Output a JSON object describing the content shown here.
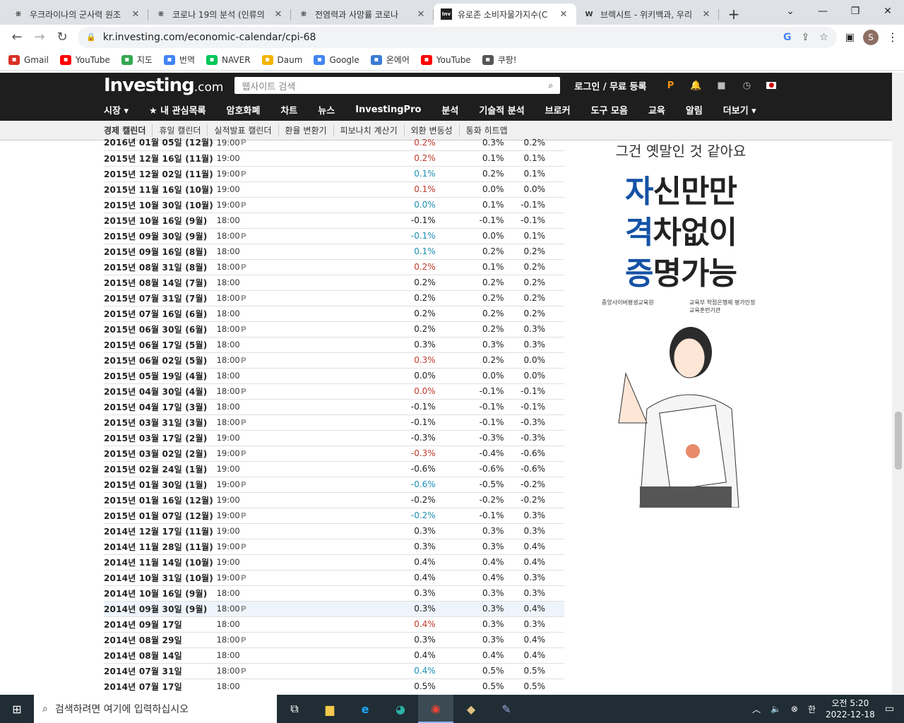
{
  "browser": {
    "tabs": [
      {
        "title": "우크라이나의 군사력 원조",
        "fav": "⁜"
      },
      {
        "title": "코로나 19의 분석 (인류의",
        "fav": "⁜"
      },
      {
        "title": "전염력과 사망률 코로나",
        "fav": "⁜"
      },
      {
        "title": "유로존 소비자물가지수(C",
        "fav": "Inv",
        "active": true
      },
      {
        "title": "브렉시트 - 위키백과, 우리",
        "fav": "W"
      }
    ],
    "url": "kr.investing.com/economic-calendar/cpi-68",
    "profile": "S",
    "bookmarks": [
      {
        "label": "Gmail",
        "icon": "gmail-icon",
        "color": "#d93025"
      },
      {
        "label": "YouTube",
        "icon": "youtube-icon",
        "color": "#ff0000"
      },
      {
        "label": "지도",
        "icon": "maps-icon",
        "color": "#34a853"
      },
      {
        "label": "번역",
        "icon": "translate-icon",
        "color": "#4285f4"
      },
      {
        "label": "NAVER",
        "icon": "naver-icon",
        "color": "#03c75a"
      },
      {
        "label": "Daum",
        "icon": "daum-icon",
        "color": "#f4b400"
      },
      {
        "label": "Google",
        "icon": "google-icon",
        "color": "#4285f4"
      },
      {
        "label": "온에어",
        "icon": "onair-icon",
        "color": "#3a7bd5"
      },
      {
        "label": "YouTube",
        "icon": "youtube-icon",
        "color": "#ff0000"
      },
      {
        "label": "쿠팡!",
        "icon": "coupang-icon",
        "color": "#555"
      }
    ]
  },
  "site": {
    "logo": "Investing",
    "logo_suffix": ".com",
    "search_placeholder": "웹사이트 검색",
    "login": "로그인 / 무료 등록",
    "nav": [
      "시장 ▾",
      "★ 내 관심목록",
      "암호화폐",
      "차트",
      "뉴스",
      "InvestingPro",
      "분석",
      "기술적 분석",
      "브로커",
      "도구 모음",
      "교육",
      "알림",
      "더보기 ▾"
    ],
    "subnav": [
      "경제 캘린더",
      "휴일 캘린더",
      "실적발표 캘린더",
      "환율 변환기",
      "피보나치 계산기",
      "외환 변동성",
      "통화 히트맵"
    ]
  },
  "table": {
    "rows": [
      {
        "date": "2016년 01월 05일 (12월)",
        "time": "19:00",
        "pre": "P",
        "actual": "0.2%",
        "ac": "red",
        "forecast": "0.3%",
        "prev": "0.2%"
      },
      {
        "date": "2015년 12월 16일 (11월)",
        "time": "19:00",
        "pre": "",
        "actual": "0.2%",
        "ac": "red",
        "forecast": "0.1%",
        "prev": "0.1%"
      },
      {
        "date": "2015년 12월 02일 (11월)",
        "time": "19:00",
        "pre": "P",
        "actual": "0.1%",
        "ac": "green",
        "forecast": "0.2%",
        "prev": "0.1%"
      },
      {
        "date": "2015년 11월 16일 (10월)",
        "time": "19:00",
        "pre": "",
        "actual": "0.1%",
        "ac": "red",
        "forecast": "0.0%",
        "prev": "0.0%"
      },
      {
        "date": "2015년 10월 30일 (10월)",
        "time": "19:00",
        "pre": "P",
        "actual": "0.0%",
        "ac": "green",
        "forecast": "0.1%",
        "prev": "-0.1%"
      },
      {
        "date": "2015년 10월 16일 (9월)",
        "time": "18:00",
        "pre": "",
        "actual": "-0.1%",
        "ac": "",
        "forecast": "-0.1%",
        "prev": "-0.1%"
      },
      {
        "date": "2015년 09월 30일 (9월)",
        "time": "18:00",
        "pre": "P",
        "actual": "-0.1%",
        "ac": "green",
        "forecast": "0.0%",
        "prev": "0.1%"
      },
      {
        "date": "2015년 09월 16일 (8월)",
        "time": "18:00",
        "pre": "",
        "actual": "0.1%",
        "ac": "green",
        "forecast": "0.2%",
        "prev": "0.2%"
      },
      {
        "date": "2015년 08월 31일 (8월)",
        "time": "18:00",
        "pre": "P",
        "actual": "0.2%",
        "ac": "red",
        "forecast": "0.1%",
        "prev": "0.2%"
      },
      {
        "date": "2015년 08월 14일 (7월)",
        "time": "18:00",
        "pre": "",
        "actual": "0.2%",
        "ac": "",
        "forecast": "0.2%",
        "prev": "0.2%"
      },
      {
        "date": "2015년 07월 31일 (7월)",
        "time": "18:00",
        "pre": "P",
        "actual": "0.2%",
        "ac": "",
        "forecast": "0.2%",
        "prev": "0.2%"
      },
      {
        "date": "2015년 07월 16일 (6월)",
        "time": "18:00",
        "pre": "",
        "actual": "0.2%",
        "ac": "",
        "forecast": "0.2%",
        "prev": "0.2%"
      },
      {
        "date": "2015년 06월 30일 (6월)",
        "time": "18:00",
        "pre": "P",
        "actual": "0.2%",
        "ac": "",
        "forecast": "0.2%",
        "prev": "0.3%"
      },
      {
        "date": "2015년 06월 17일 (5월)",
        "time": "18:00",
        "pre": "",
        "actual": "0.3%",
        "ac": "",
        "forecast": "0.3%",
        "prev": "0.3%"
      },
      {
        "date": "2015년 06월 02일 (5월)",
        "time": "18:00",
        "pre": "P",
        "actual": "0.3%",
        "ac": "red",
        "forecast": "0.2%",
        "prev": "0.0%"
      },
      {
        "date": "2015년 05월 19일 (4월)",
        "time": "18:00",
        "pre": "",
        "actual": "0.0%",
        "ac": "",
        "forecast": "0.0%",
        "prev": "0.0%"
      },
      {
        "date": "2015년 04월 30일 (4월)",
        "time": "18:00",
        "pre": "P",
        "actual": "0.0%",
        "ac": "red",
        "forecast": "-0.1%",
        "prev": "-0.1%"
      },
      {
        "date": "2015년 04월 17일 (3월)",
        "time": "18:00",
        "pre": "",
        "actual": "-0.1%",
        "ac": "",
        "forecast": "-0.1%",
        "prev": "-0.1%"
      },
      {
        "date": "2015년 03월 31일 (3월)",
        "time": "18:00",
        "pre": "P",
        "actual": "-0.1%",
        "ac": "",
        "forecast": "-0.1%",
        "prev": "-0.3%"
      },
      {
        "date": "2015년 03월 17일 (2월)",
        "time": "19:00",
        "pre": "",
        "actual": "-0.3%",
        "ac": "",
        "forecast": "-0.3%",
        "prev": "-0.3%"
      },
      {
        "date": "2015년 03월 02일 (2월)",
        "time": "19:00",
        "pre": "P",
        "actual": "-0.3%",
        "ac": "red",
        "forecast": "-0.4%",
        "prev": "-0.6%"
      },
      {
        "date": "2015년 02월 24일 (1월)",
        "time": "19:00",
        "pre": "",
        "actual": "-0.6%",
        "ac": "",
        "forecast": "-0.6%",
        "prev": "-0.6%"
      },
      {
        "date": "2015년 01월 30일 (1월)",
        "time": "19:00",
        "pre": "P",
        "actual": "-0.6%",
        "ac": "green",
        "forecast": "-0.5%",
        "prev": "-0.2%"
      },
      {
        "date": "2015년 01월 16일 (12월)",
        "time": "19:00",
        "pre": "",
        "actual": "-0.2%",
        "ac": "",
        "forecast": "-0.2%",
        "prev": "-0.2%"
      },
      {
        "date": "2015년 01월 07일 (12월)",
        "time": "19:00",
        "pre": "P",
        "actual": "-0.2%",
        "ac": "green",
        "forecast": "-0.1%",
        "prev": "0.3%"
      },
      {
        "date": "2014년 12월 17일 (11월)",
        "time": "19:00",
        "pre": "",
        "actual": "0.3%",
        "ac": "",
        "forecast": "0.3%",
        "prev": "0.3%"
      },
      {
        "date": "2014년 11월 28일 (11월)",
        "time": "19:00",
        "pre": "P",
        "actual": "0.3%",
        "ac": "",
        "forecast": "0.3%",
        "prev": "0.4%"
      },
      {
        "date": "2014년 11월 14일 (10월)",
        "time": "19:00",
        "pre": "",
        "actual": "0.4%",
        "ac": "",
        "forecast": "0.4%",
        "prev": "0.4%"
      },
      {
        "date": "2014년 10월 31일 (10월)",
        "time": "19:00",
        "pre": "P",
        "actual": "0.4%",
        "ac": "",
        "forecast": "0.4%",
        "prev": "0.3%"
      },
      {
        "date": "2014년 10월 16일 (9월)",
        "time": "18:00",
        "pre": "",
        "actual": "0.3%",
        "ac": "",
        "forecast": "0.3%",
        "prev": "0.3%"
      },
      {
        "date": "2014년 09월 30일 (9월)",
        "time": "18:00",
        "pre": "P",
        "actual": "0.3%",
        "ac": "",
        "forecast": "0.3%",
        "prev": "0.4%",
        "hl": true
      },
      {
        "date": "2014년 09월 17일",
        "time": "18:00",
        "pre": "",
        "actual": "0.4%",
        "ac": "red",
        "forecast": "0.3%",
        "prev": "0.3%"
      },
      {
        "date": "2014년 08월 29일",
        "time": "18:00",
        "pre": "P",
        "actual": "0.3%",
        "ac": "",
        "forecast": "0.3%",
        "prev": "0.4%"
      },
      {
        "date": "2014년 08월 14일",
        "time": "18:00",
        "pre": "",
        "actual": "0.4%",
        "ac": "",
        "forecast": "0.4%",
        "prev": "0.4%"
      },
      {
        "date": "2014년 07월 31일",
        "time": "18:00",
        "pre": "P",
        "actual": "0.4%",
        "ac": "green",
        "forecast": "0.5%",
        "prev": "0.5%"
      },
      {
        "date": "2014년 07월 17일",
        "time": "18:00",
        "pre": "",
        "actual": "0.5%",
        "ac": "",
        "forecast": "0.5%",
        "prev": "0.5%"
      }
    ]
  },
  "ad": {
    "line1": "그건 옛말인 것 같아요",
    "lines": [
      [
        "자",
        "신만만"
      ],
      [
        "격",
        "차없이"
      ],
      [
        "증",
        "명가능"
      ]
    ],
    "org1": "중앙사이버평생교육원",
    "org2": "교육부 학점은행제 평가인정 교육훈련기관"
  },
  "taskbar": {
    "search": "검색하려면 여기에 입력하십시오",
    "time": "오전 5:20",
    "date": "2022-12-18",
    "ime": "한"
  }
}
